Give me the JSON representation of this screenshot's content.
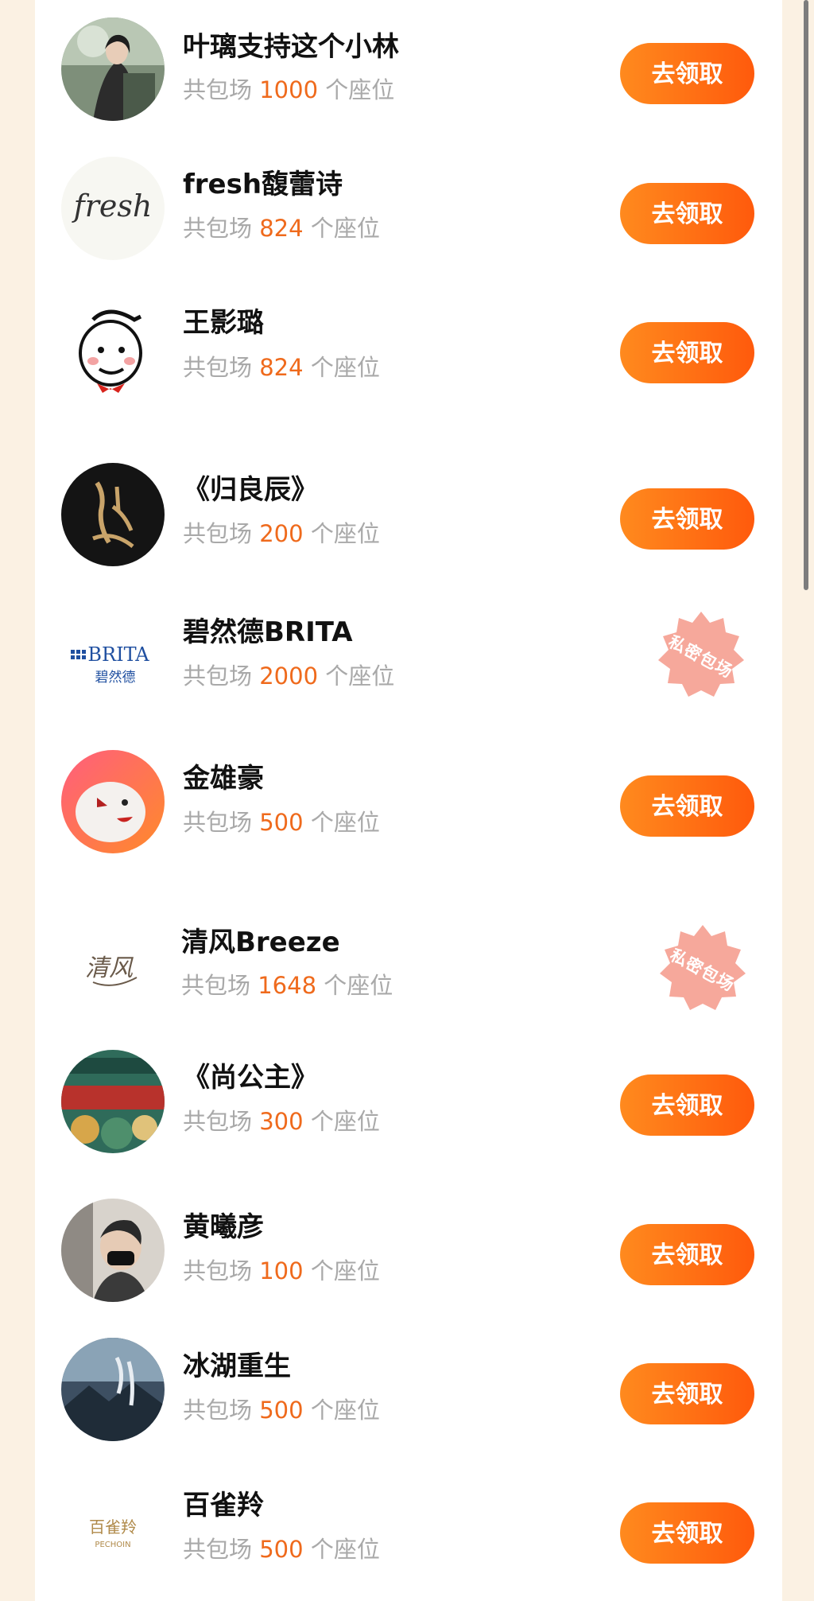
{
  "seat_prefix": "共包场",
  "seat_suffix": "个座位",
  "claim_label": "去领取",
  "private_label": "私密包场",
  "colors": {
    "accent": "#ef6a1c",
    "button_start": "#ff8a1e",
    "button_end": "#ff5a0c",
    "page_background": "#fbf1e3",
    "seal": "#f6a89b"
  },
  "rows": [
    {
      "name": "叶璃支持这个小林",
      "seats": "1000",
      "action": "claim"
    },
    {
      "name": "fresh馥蕾诗",
      "seats": "824",
      "action": "claim",
      "logo_text": "fresh"
    },
    {
      "name": "王影璐",
      "seats": "824",
      "action": "claim"
    },
    {
      "name": "《归良辰》",
      "seats": "200",
      "action": "claim"
    },
    {
      "name": "碧然德BRITA",
      "seats": "2000",
      "action": "private",
      "logo_text": "BRITA",
      "logo_subtext": "碧然德"
    },
    {
      "name": "金雄豪",
      "seats": "500",
      "action": "claim"
    },
    {
      "name": "清风Breeze",
      "seats": "1648",
      "action": "private",
      "logo_text": "清风"
    },
    {
      "name": "《尚公主》",
      "seats": "300",
      "action": "claim"
    },
    {
      "name": "黄曦彦",
      "seats": "100",
      "action": "claim"
    },
    {
      "name": "冰湖重生",
      "seats": "500",
      "action": "claim"
    },
    {
      "name": "百雀羚",
      "seats": "500",
      "action": "claim",
      "logo_text": "百雀羚",
      "logo_subtext": "PECHOIN"
    }
  ]
}
